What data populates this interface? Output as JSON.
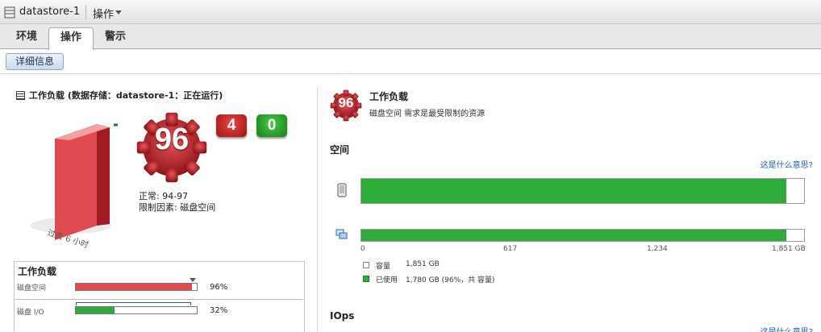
{
  "titlebar": {
    "title": "datastore-1",
    "actions": "操作"
  },
  "tabs": [
    {
      "label": "环境"
    },
    {
      "label": "操作"
    },
    {
      "label": "警示"
    }
  ],
  "details_button": "详细信息",
  "left": {
    "heading": "工作负载 (数据存储：datastore-1：正在运行)",
    "past_label": "过去 6 小时",
    "score": "96",
    "badge_red": "4",
    "badge_green": "0",
    "normal": "正常: 94-97",
    "limit": "限制因素: 磁盘空间",
    "workload": {
      "title": "工作负载",
      "rows": [
        {
          "label": "磁盘空间",
          "percent_text": "96%",
          "percent": 96,
          "color": "#e04b4f"
        },
        {
          "label": "磁盘 I/O",
          "percent_text": "32%",
          "percent": 32,
          "color": "#2fab3c"
        }
      ]
    }
  },
  "right": {
    "score": "96",
    "title": "工作负载",
    "subtitle": "磁盘空间 需求是最受限制的资源",
    "space_label": "空间",
    "help_link": "这是什么意思?",
    "bars": [
      {
        "fill_percent": 96
      },
      {
        "fill_percent": 96
      }
    ],
    "ticks": [
      "0",
      "617",
      "1,234",
      "1,851 GB"
    ],
    "legend": [
      {
        "label": "容量",
        "value": "1,851 GB",
        "color": "#ffffff"
      },
      {
        "label": "已使用",
        "value": "1,780 GB (96%，共 容量)",
        "color": "#2fab3c"
      }
    ],
    "iops_label": "IOps",
    "help_link2": "这是什么意思?"
  },
  "colors": {
    "accent_red": "#c0262c",
    "accent_green": "#2fab3c",
    "link": "#1a5ea8"
  }
}
